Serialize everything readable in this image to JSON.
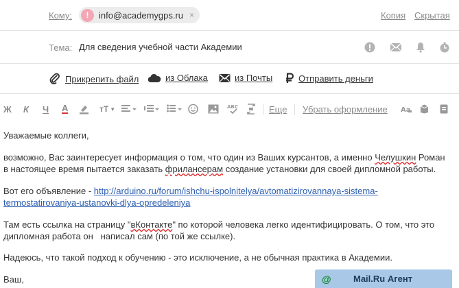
{
  "header": {
    "to_label": "Кому:",
    "recipient": {
      "initial": "!",
      "email": "info@academygps.ru",
      "remove": "×"
    },
    "copy_link": "Копия",
    "hidden_link": "Скрытая",
    "subject_label": "Тема:",
    "subject": "Для сведения учебной части Академии"
  },
  "attachments": {
    "file": "Прикрепить файл",
    "cloud": "из Облака",
    "mail": "из Почты",
    "money": "Отправить деньги"
  },
  "toolbar": {
    "bold": "Ж",
    "italic": "К",
    "underline": "Ч",
    "font_color": "А",
    "font_size": "тТ",
    "more": "Еще",
    "clear_format": "Убрать оформление"
  },
  "message": {
    "greeting": "Уважаемые коллеги,",
    "p1_start": "возможно, Вас заинтересует информация о том, что один из Ваших курсантов, а именно ",
    "p1_name": "Челушкин",
    "p1_mid": " Роман",
    "p1_line2_start": "в настоящее время пытается заказать ",
    "p1_word": "фрилансерам",
    "p1_line2_end": " создание установки для своей дипломной работы.",
    "p2_prefix": "Вот его объявление - ",
    "p2_link_line1": "http://arduino.ru/forum/ishchu-ispolnitelya/avtomatizirovannaya-sistema-",
    "p2_link_line2": "termostatirovaniya-ustanovki-dlya-opredeleniya",
    "p3_start": "Там есть ссылка на страницу \"",
    "p3_word": "вКонтакте",
    "p3_end": "\" по которой человека легко идентифицировать. О том, что это",
    "p3_line2": "дипломная работа он   написал сам (по той же ссылке).",
    "p4": "Надеюсь, что такой подход к обучению - это исключение, а не обычная практика в Академии.",
    "closing": "Ваш,"
  },
  "agent": {
    "icon": "@",
    "label": "Mail.Ru Агент"
  }
}
